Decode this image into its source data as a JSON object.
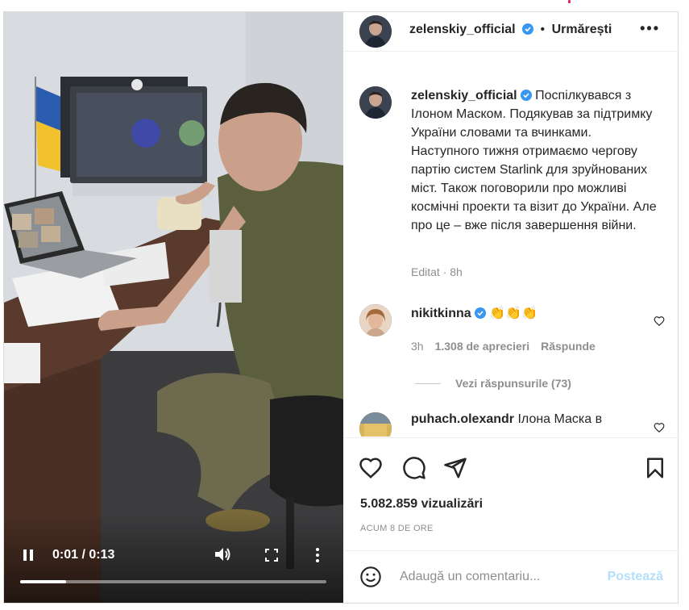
{
  "video": {
    "time_current": "0:01",
    "time_total": "0:13",
    "time_display": "0:01 / 0:13",
    "progress_fraction": 0.15,
    "icons": [
      "pause-icon",
      "volume-icon",
      "fullscreen-icon",
      "more-vert-icon"
    ]
  },
  "header": {
    "username": "zelenskiy_official",
    "separator": "•",
    "follow_label": "Urmărești",
    "more_label": "•••"
  },
  "caption": {
    "username": "zelenskiy_official",
    "text": "Поспілкувався з Ілоном Маском. Подякував за підтримку України словами та вчинками. Наступного тижня отримаємо чергову партію систем Starlink для зруйнованих міст. Також поговорили про можливі космічні проекти та візит до України. Але про це – вже після завершення війни.",
    "edited": "Editat",
    "dot": "·",
    "age": "8h"
  },
  "comments": [
    {
      "username": "nikitkinna",
      "text": "👏👏👏",
      "age": "3h",
      "likes": "1.308 de aprecieri",
      "reply_label": "Răspunde",
      "view_replies": "Vezi răspunsurile (73)"
    },
    {
      "username": "puhach.olexandr",
      "text": "Ілона Маска в"
    }
  ],
  "actions": {
    "icons": [
      "heart-icon",
      "comment-icon",
      "share-icon",
      "bookmark-icon"
    ]
  },
  "views_label": "5.082.859 vizualizări",
  "time_ago": "ACUM 8 DE ORE",
  "add_comment": {
    "placeholder": "Adaugă un comentariu...",
    "post_label": "Postează"
  },
  "colors": {
    "verified_blue": "#3897f0",
    "post_disabled": "#b2dffc",
    "muted_text": "#8e8e8e",
    "flag_blue": "#2a5db0",
    "flag_yellow": "#f2c12e"
  }
}
